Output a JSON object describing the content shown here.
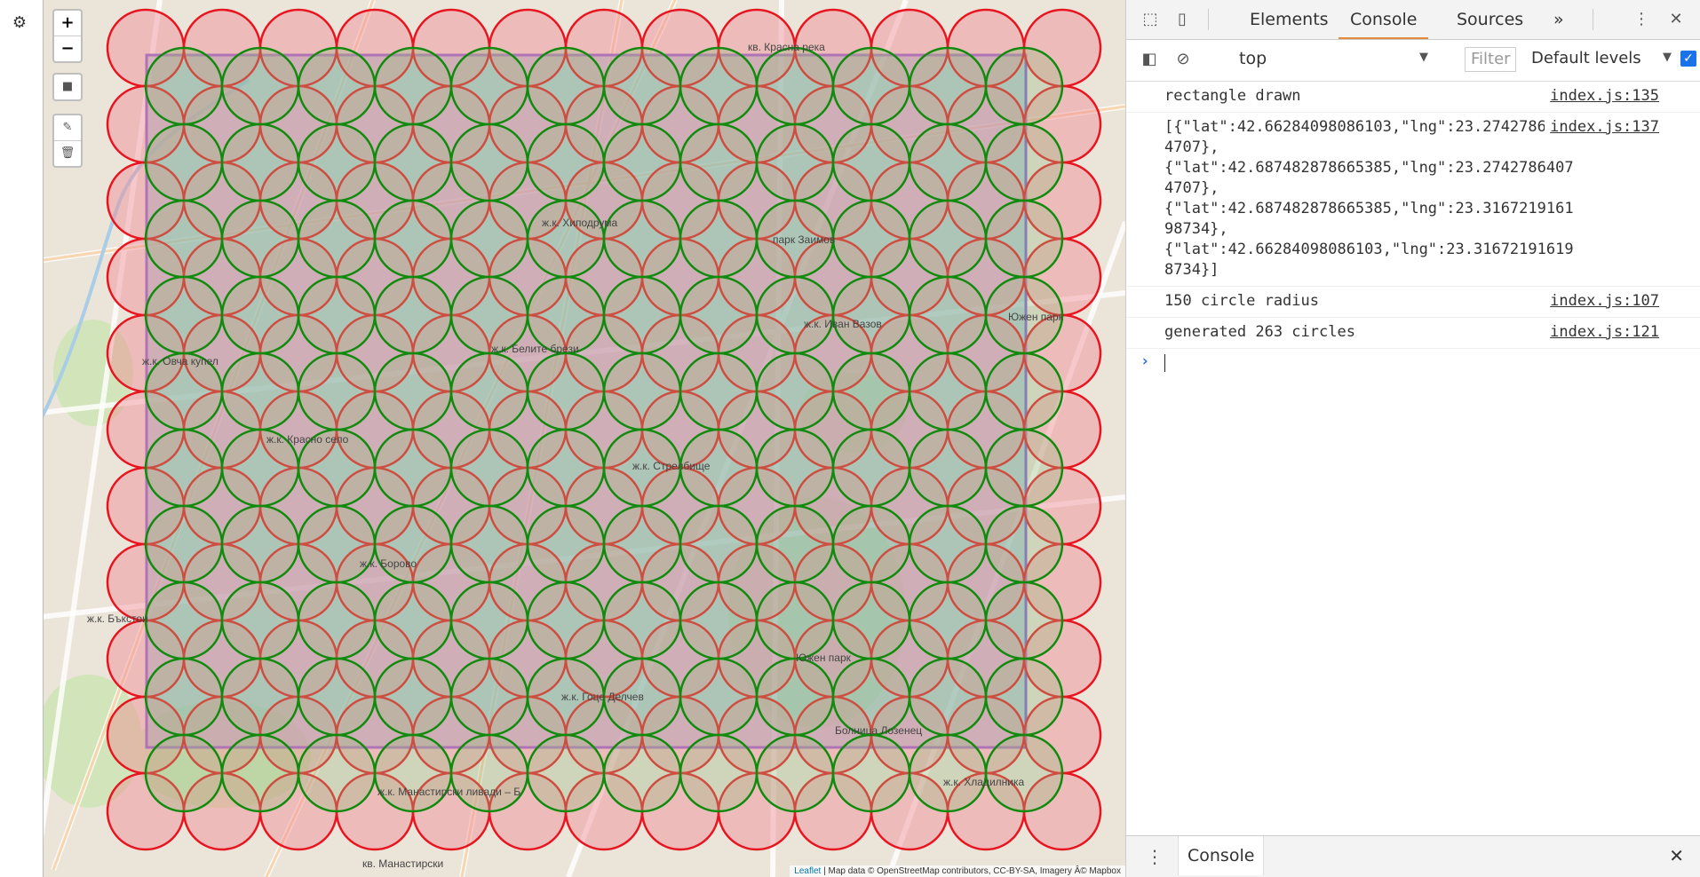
{
  "map": {
    "zoom_in": "+",
    "zoom_out": "−",
    "draw_rectangle_icon": "square",
    "edit_icon": "edit",
    "delete_icon": "trash",
    "settings_icon": "gear",
    "attribution": {
      "leaflet": "Leaflet",
      "rest": " | Map data © OpenStreetMap contributors, CC-BY-SA, Imagery Â© Mapbox"
    },
    "labels": [
      "кв. Красна река",
      "ж.к. Хиподрума",
      "парк Заимов",
      "ж.к. Иван Вазов",
      "Южен парк",
      "ж.к. Белите брези",
      "ж.к. Красно село",
      "ж.к. Стрелбище",
      "ж.к. Борово",
      "ж.к. Гоце Делчев",
      "Южен парк",
      "ж.к. Хладилника",
      "ж.к. Манастирски ливади – Б",
      "кв. Манастирски",
      "ж.к. Овча купел",
      "Болница Лозенец",
      "ж.к. Бъкстон"
    ],
    "circle_colors": {
      "outer_stroke": "#e8141f",
      "outer_fill": "#f08b95",
      "inner_stroke": "#118a0e",
      "inner_fill": "#9bb982",
      "rectangle_stroke": "#7c5fd1",
      "rectangle_fill": "#8cb6cf"
    }
  },
  "devtools": {
    "tabs": [
      "Elements",
      "Console",
      "Sources"
    ],
    "active_tab": "Console",
    "more_tabs": "»",
    "context": "top",
    "filter_placeholder": "Filter",
    "levels": "Default levels",
    "messages": [
      {
        "text": "rectangle drawn",
        "source": "index.js:135"
      },
      {
        "text": "[{\"lat\":42.66284098086103,\"lng\":23.27427864074707},\n{\"lat\":42.687482878665385,\"lng\":23.27427864074707},\n{\"lat\":42.687482878665385,\"lng\":23.316721916198734},\n{\"lat\":42.66284098086103,\"lng\":23.316721916198734}]",
        "source": "index.js:137"
      },
      {
        "text": "150 circle radius",
        "source": "index.js:107"
      },
      {
        "text": "generated 263 circles",
        "source": "index.js:121"
      }
    ],
    "drawer_tab": "Console"
  }
}
